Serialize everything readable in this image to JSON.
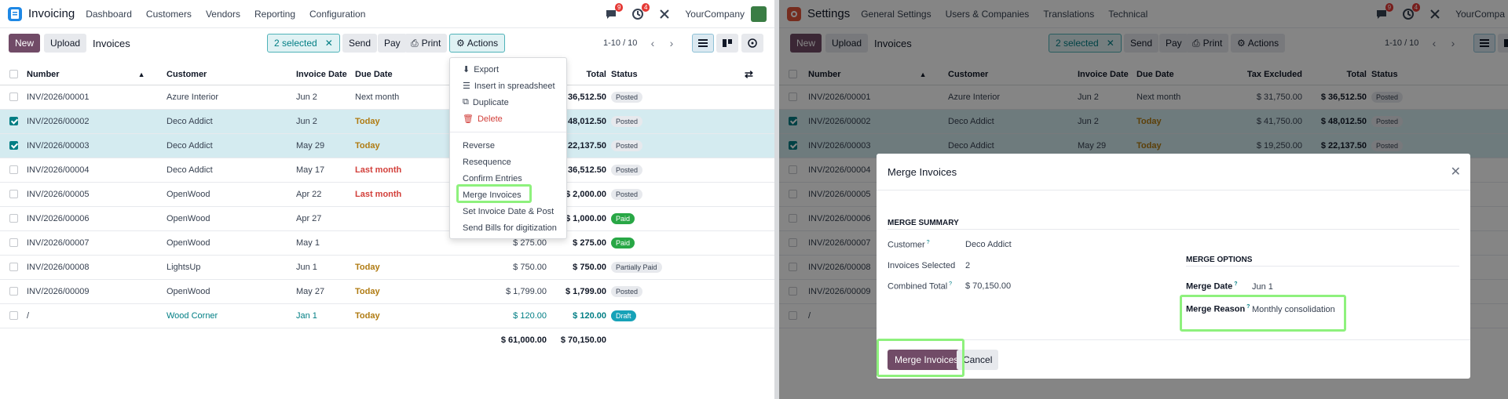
{
  "left": {
    "app_name": "Invoicing",
    "menu": [
      "Dashboard",
      "Customers",
      "Vendors",
      "Reporting",
      "Configuration"
    ],
    "chat_badge": "9",
    "activity_badge": "4",
    "company": "YourCompany",
    "new_label": "New",
    "upload_label": "Upload",
    "breadcrumb": "Invoices",
    "selected_label": "2 selected",
    "send_label": "Send",
    "pay_label": "Pay",
    "print_label": "Print",
    "actions_label": "Actions",
    "pager": "1-10 / 10",
    "columns": {
      "number": "Number",
      "customer": "Customer",
      "invoice_date": "Invoice Date",
      "due_date": "Due Date",
      "total": "Total",
      "status": "Status"
    },
    "rows": [
      {
        "number": "INV/2026/00001",
        "customer": "Azure Interior",
        "date": "Jun 2",
        "due": "Next month",
        "total": "$ 36,512.50",
        "status": "Posted"
      },
      {
        "number": "INV/2026/00002",
        "customer": "Deco Addict",
        "date": "Jun 2",
        "due": "Today",
        "total": "$ 48,012.50",
        "status": "Posted"
      },
      {
        "number": "INV/2026/00003",
        "customer": "Deco Addict",
        "date": "May 29",
        "due": "Today",
        "total": "$ 22,137.50",
        "status": "Posted"
      },
      {
        "number": "INV/2026/00004",
        "customer": "Deco Addict",
        "date": "May 17",
        "due": "Last month",
        "total": "$ 36,512.50",
        "status": "Posted"
      },
      {
        "number": "INV/2026/00005",
        "customer": "OpenWood",
        "date": "Apr 22",
        "due": "Last month",
        "total": "$ 2,000.00",
        "status": "Posted"
      },
      {
        "number": "INV/2026/00006",
        "customer": "OpenWood",
        "date": "Apr 27",
        "due": "",
        "taxex": "$ 1,000.00",
        "total": "$ 1,000.00",
        "status": "Paid"
      },
      {
        "number": "INV/2026/00007",
        "customer": "OpenWood",
        "date": "May 1",
        "due": "",
        "taxex": "$ 275.00",
        "total": "$ 275.00",
        "status": "Paid"
      },
      {
        "number": "INV/2026/00008",
        "customer": "LightsUp",
        "date": "Jun 1",
        "due": "Today",
        "taxex": "$ 750.00",
        "total": "$ 750.00",
        "status": "Partially Paid"
      },
      {
        "number": "INV/2026/00009",
        "customer": "OpenWood",
        "date": "May 27",
        "due": "Today",
        "taxex": "$ 1,799.00",
        "total": "$ 1,799.00",
        "status": "Posted"
      },
      {
        "number": "/",
        "customer": "Wood Corner",
        "date": "Jan 1",
        "due": "Today",
        "taxex": "$ 120.00",
        "total": "$ 120.00",
        "status": "Draft"
      }
    ],
    "sum_taxex": "$ 61,000.00",
    "sum_total": "$ 70,150.00",
    "actions_menu": [
      "Export",
      "Insert in spreadsheet",
      "Duplicate",
      "Delete",
      "Reverse",
      "Resequence",
      "Confirm Entries",
      "Merge Invoices",
      "Set Invoice Date & Post",
      "Send Bills for digitization"
    ]
  },
  "right": {
    "app_name": "Settings",
    "menu": [
      "General Settings",
      "Users & Companies",
      "Translations",
      "Technical"
    ],
    "chat_badge": "9",
    "activity_badge": "4",
    "company": "YourCompa",
    "new_label": "New",
    "upload_label": "Upload",
    "breadcrumb": "Invoices",
    "selected_label": "2 selected",
    "send_label": "Send",
    "pay_label": "Pay",
    "print_label": "Print",
    "actions_label": "Actions",
    "pager": "1-10 / 10",
    "columns": {
      "number": "Number",
      "customer": "Customer",
      "invoice_date": "Invoice Date",
      "due_date": "Due Date",
      "tax_excluded": "Tax Excluded",
      "total": "Total",
      "status": "Status"
    },
    "rows": [
      {
        "number": "INV/2026/00001",
        "customer": "Azure Interior",
        "date": "Jun 2",
        "due": "Next month",
        "taxex": "$ 31,750.00",
        "total": "$ 36,512.50",
        "status": "Posted"
      },
      {
        "number": "INV/2026/00002",
        "customer": "Deco Addict",
        "date": "Jun 2",
        "due": "Today",
        "taxex": "$ 41,750.00",
        "total": "$ 48,012.50",
        "status": "Posted"
      },
      {
        "number": "INV/2026/00003",
        "customer": "Deco Addict",
        "date": "May 29",
        "due": "Today",
        "taxex": "$ 19,250.00",
        "total": "$ 22,137.50",
        "status": "Posted"
      },
      {
        "number": "INV/2026/00004"
      },
      {
        "number": "INV/2026/00005"
      },
      {
        "number": "INV/2026/00006"
      },
      {
        "number": "INV/2026/00007"
      },
      {
        "number": "INV/2026/00008"
      },
      {
        "number": "INV/2026/00009"
      },
      {
        "number": "/"
      }
    ],
    "modal": {
      "title": "Merge Invoices",
      "summary_heading": "MERGE SUMMARY",
      "customer_label": "Customer",
      "customer_value": "Deco Addict",
      "selected_label": "Invoices Selected",
      "selected_value": "2",
      "combined_label": "Combined Total",
      "combined_value": "$ 70,150.00",
      "options_heading": "MERGE OPTIONS",
      "date_label": "Merge Date",
      "date_value": "Jun 1",
      "reason_label": "Merge Reason",
      "reason_value": "Monthly consolidation",
      "merge_button": "Merge Invoices",
      "cancel_button": "Cancel"
    }
  },
  "colors": {
    "brand": "#714b67",
    "accent": "#017e84",
    "highlight": "#8ef17d",
    "today": "#b07b12",
    "overdue": "#d23f3a",
    "paid": "#28a745",
    "draft": "#17a2b8"
  }
}
